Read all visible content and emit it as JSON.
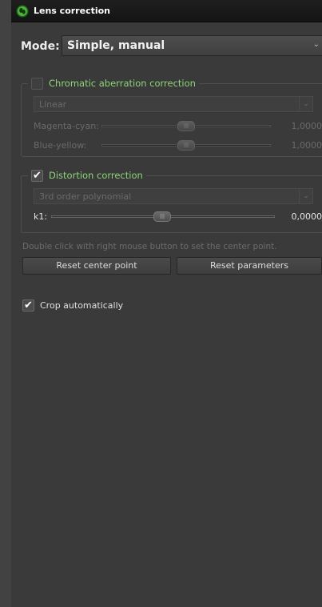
{
  "titlebar": {
    "title": "Lens correction",
    "logo_icon": "green-eye-logo-icon"
  },
  "mode": {
    "label": "Mode:",
    "value": "Simple, manual",
    "arrow_icon": "chevron-down-icon"
  },
  "chromatic": {
    "checked": false,
    "enabled": false,
    "title": "Chromatic aberration correction",
    "method": "Linear",
    "sliders": [
      {
        "label": "Magenta-cyan:",
        "value_text": "1,00000",
        "position": 0.5
      },
      {
        "label": "Blue-yellow:",
        "value_text": "1,00000",
        "position": 0.5
      }
    ]
  },
  "distortion": {
    "checked": true,
    "enabled": true,
    "title": "Distortion correction",
    "method": "3rd order polynomial",
    "slider": {
      "label": "k1:",
      "value_text": "0,00000",
      "position": 0.5
    }
  },
  "hint": "Double click with right mouse button to set the center point.",
  "buttons": {
    "reset_center": "Reset center point",
    "reset_params": "Reset parameters"
  },
  "crop": {
    "checked": true,
    "label": "Crop automatically"
  },
  "colors": {
    "legend_green": "#8fd37b",
    "background": "#3a3a3a",
    "titlebar": "#1a1a1a"
  }
}
